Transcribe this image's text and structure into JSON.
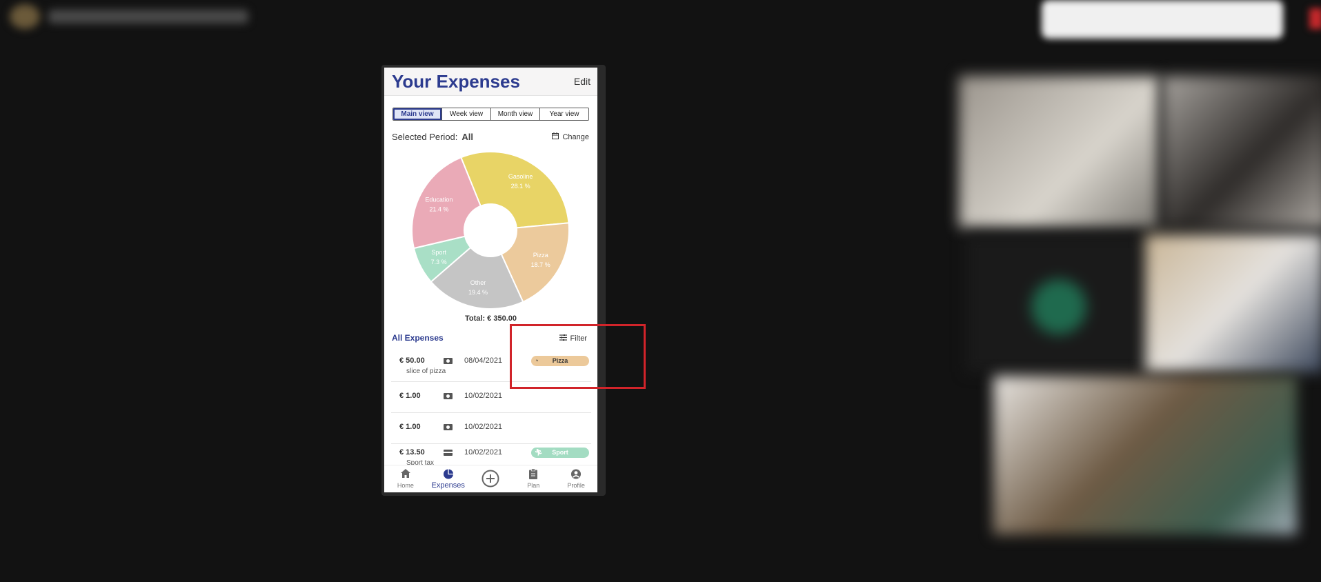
{
  "app": {
    "title": "Your Expenses",
    "edit_label": "Edit"
  },
  "tabs": [
    {
      "label": "Main view",
      "active": true
    },
    {
      "label": "Week view",
      "active": false
    },
    {
      "label": "Month view",
      "active": false
    },
    {
      "label": "Year view",
      "active": false
    }
  ],
  "period": {
    "label": "Selected Period:",
    "value": "All",
    "change_label": "Change"
  },
  "chart_data": {
    "type": "pie",
    "categories": [
      "Gasoline",
      "Pizza",
      "Other",
      "Sport",
      "Education"
    ],
    "values": [
      28.1,
      18.7,
      19.4,
      7.3,
      21.4
    ],
    "value_labels": [
      "28.1 %",
      "18.7 %",
      "19.4 %",
      "7.3 %",
      "21.4 %"
    ],
    "colors": [
      "#e8d466",
      "#ecca9c",
      "#c5c5c5",
      "#a9dfc6",
      "#eaaab7"
    ],
    "title": "",
    "total": "Total: € 350.00"
  },
  "expenses_section": {
    "title": "All Expenses",
    "filter_label": "Filter"
  },
  "expenses": [
    {
      "amount": "€ 50.00",
      "description": "slice of pizza",
      "date": "08/04/2021",
      "payment_icon": "cash-icon",
      "category": "Pizza",
      "category_icon": "pizza-icon"
    },
    {
      "amount": "€ 1.00",
      "description": "",
      "date": "10/02/2021",
      "payment_icon": "cash-icon",
      "category": "",
      "category_icon": ""
    },
    {
      "amount": "€ 1.00",
      "description": "",
      "date": "10/02/2021",
      "payment_icon": "cash-icon",
      "category": "",
      "category_icon": ""
    },
    {
      "amount": "€ 13.50",
      "description": "Sport tax",
      "date": "10/02/2021",
      "payment_icon": "credit-card-icon",
      "category": "Sport",
      "category_icon": "running-icon"
    }
  ],
  "bottom_nav": [
    {
      "label": "Home",
      "icon": "home-icon",
      "active": false
    },
    {
      "label": "Expenses",
      "icon": "pie-chart-icon",
      "active": true
    },
    {
      "label": "",
      "icon": "add-circle-icon",
      "active": false
    },
    {
      "label": "Plan",
      "icon": "clipboard-icon",
      "active": false
    },
    {
      "label": "Profile",
      "icon": "profile-icon",
      "active": false
    }
  ],
  "colors": {
    "brand": "#2c3b8f",
    "highlight": "#d1242a",
    "background": "#121212"
  }
}
